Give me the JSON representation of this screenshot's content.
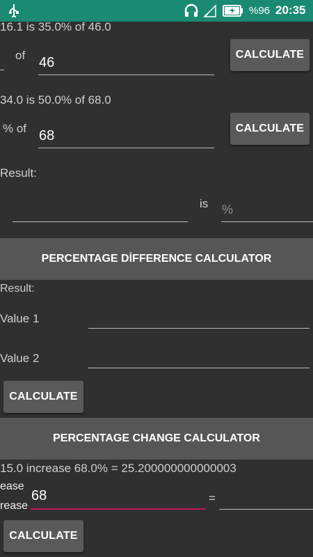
{
  "status_bar": {
    "battery_percent": "%96",
    "time": "20:35",
    "color": "#1b8a72"
  },
  "section1": {
    "result_a": "16.1 is 35.0% of 46.0",
    "of_label": "of",
    "value_a": "46",
    "calculate_a": "CALCULATE",
    "result_b": "34.0 is 50.0% of 68.0",
    "percent_of_label": "% of",
    "value_b": "68",
    "calculate_b": "CALCULATE",
    "result_label": "Result:",
    "is_label": "is",
    "percent_placeholder": "%"
  },
  "difference": {
    "header": "PERCENTAGE DİFFERENCE CALCULATOR",
    "result_label": "Result:",
    "value1_label": "Value 1",
    "value2_label": "Value 2",
    "calculate": "CALCULATE"
  },
  "change": {
    "header": "PERCENTAGE CHANGE CALCULATOR",
    "result": "15.0 increase 68.0% = 25.200000000000003",
    "label_top": "ease",
    "label_bottom": "rease",
    "value": "68",
    "equals": "=",
    "calculate": "CALCULATE",
    "accent_color": "#c2185b"
  }
}
